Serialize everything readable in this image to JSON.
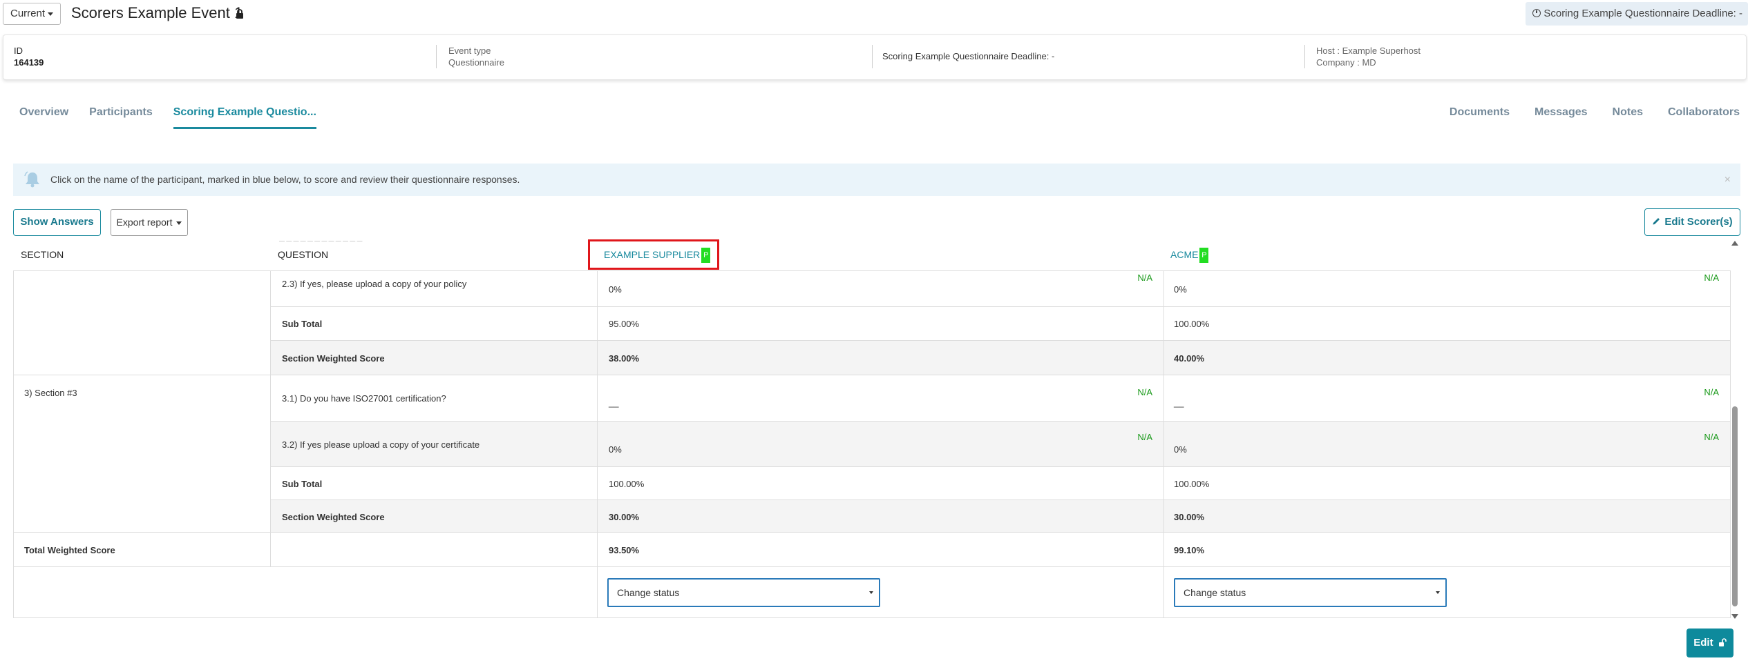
{
  "header": {
    "version_selector": "Current",
    "event_title": "Scorers Example Event 1",
    "deadline_pill": "Scoring Example Questionnaire Deadline: -"
  },
  "info": {
    "id_label": "ID",
    "id_value": "164139",
    "event_type_label": "Event type",
    "event_type_value": "Questionnaire",
    "deadline": "Scoring Example Questionnaire Deadline: -",
    "host": "Host : Example Superhost",
    "company": "Company : MD"
  },
  "tabs": {
    "left": [
      "Overview",
      "Participants",
      "Scoring Example Questio..."
    ],
    "right": [
      "Documents",
      "Messages",
      "Notes",
      "Collaborators"
    ]
  },
  "alert": {
    "text": "Click on the name of the participant, marked in blue below, to score and review their questionnaire responses.",
    "close": "×"
  },
  "toolbar": {
    "show_answers": "Show Answers",
    "export_report": "Export report",
    "edit_scorers": "Edit Scorer(s)"
  },
  "table": {
    "headers": {
      "section": "SECTION",
      "question": "QUESTION",
      "participant1": "EXAMPLE SUPPLIER",
      "participant2": "ACME",
      "badge": "P"
    },
    "na": "N/A",
    "dash": "__",
    "rows": {
      "q23": "2.3) If yes, please upload a copy of your policy",
      "q23_p1": "0%",
      "q23_p2": "0%",
      "subtotal_label": "Sub Total",
      "s2_subtotal_p1": "95.00%",
      "s2_subtotal_p2": "100.00%",
      "weighted_label": "Section Weighted Score",
      "s2_weighted_p1": "38.00%",
      "s2_weighted_p2": "40.00%",
      "section3": "3) Section #3",
      "q31": "3.1) Do you have ISO27001 certification?",
      "q32": "3.2) If yes please upload a copy of your certificate",
      "q32_p1": "0%",
      "q32_p2": "0%",
      "s3_subtotal_p1": "100.00%",
      "s3_subtotal_p2": "100.00%",
      "s3_weighted_p1": "30.00%",
      "s3_weighted_p2": "30.00%",
      "total_label": "Total Weighted Score",
      "total_p1": "93.50%",
      "total_p2": "99.10%"
    },
    "change_status": "Change status"
  },
  "footer": {
    "edit": "Edit"
  }
}
